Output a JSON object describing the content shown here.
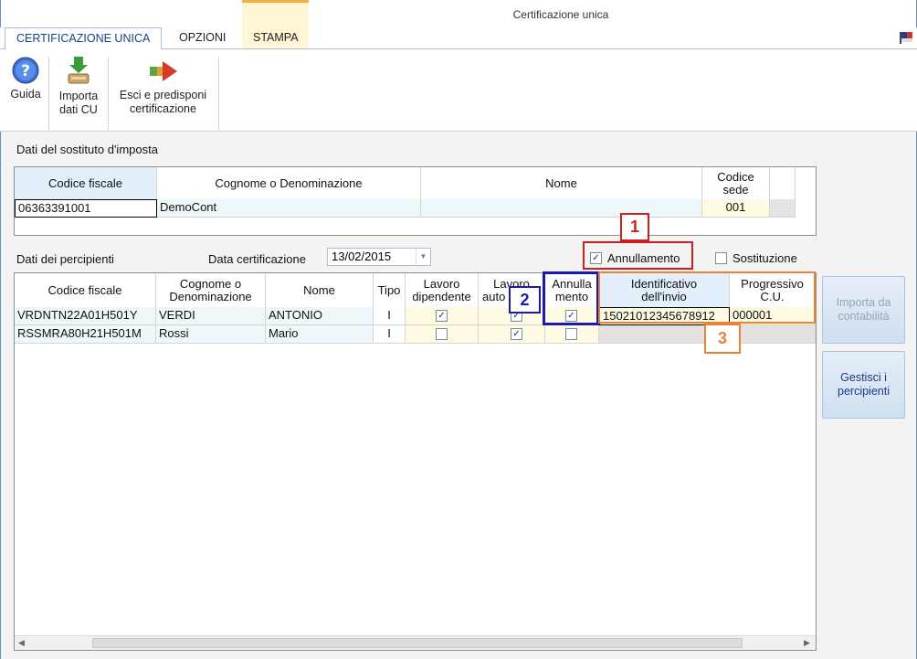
{
  "window": {
    "title": "Certificazione unica"
  },
  "tabs": [
    {
      "label": "CERTIFICAZIONE UNICA"
    },
    {
      "label": "OPZIONI"
    },
    {
      "label": "STAMPA"
    }
  ],
  "ribbon": {
    "help": "Guida",
    "import_l1": "Importa",
    "import_l2": "dati CU",
    "exit_l1": "Esci e predisponi",
    "exit_l2": "certificazione"
  },
  "sostituto": {
    "section_label": "Dati del sostituto d'imposta",
    "headers": {
      "cf": "Codice fiscale",
      "cognome": "Cognome o Denominazione",
      "nome": "Nome",
      "sede_l1": "Codice",
      "sede_l2": "sede"
    },
    "row": {
      "cf": "06363391001",
      "cognome": "DemoCont",
      "nome": "",
      "sede": "001"
    }
  },
  "percipienti": {
    "section_label": "Dati dei percipienti",
    "date_label": "Data certificazione",
    "date_value": "13/02/2015",
    "annullamento_label": "Annullamento",
    "annullamento_checked": true,
    "sostituzione_label": "Sostituzione",
    "sostituzione_checked": false,
    "headers": {
      "cf": "Codice fiscale",
      "cognome_l1": "Cognome o",
      "cognome_l2": "Denominazione",
      "nome": "Nome",
      "tipo": "Tipo",
      "ld_l1": "Lavoro",
      "ld_l2": "dipendente",
      "la_l1": "Lavoro",
      "la_l2": "auto",
      "ann_l1": "Annulla",
      "ann_l2": "mento",
      "id_l1": "Identificativo",
      "id_l2": "dell'invio",
      "prog_l1": "Progressivo",
      "prog_l2": "C.U."
    },
    "rows": [
      {
        "cf": "VRDNTN22A01H501Y",
        "cognome": "VERDI",
        "nome": "ANTONIO",
        "tipo": "I",
        "lav_dip": true,
        "lav_auto": true,
        "annullamento": true,
        "identificativo": "15021012345678912",
        "progressivo": "000001"
      },
      {
        "cf": "RSSMRA80H21H501M",
        "cognome": "Rossi",
        "nome": "Mario",
        "tipo": "I",
        "lav_dip": false,
        "lav_auto": true,
        "annullamento": false,
        "identificativo": "",
        "progressivo": ""
      }
    ]
  },
  "side_buttons": {
    "importa_l1": "Importa da",
    "importa_l2": "contabilità",
    "gestisci_l1": "Gestisci i",
    "gestisci_l2": "percipienti"
  },
  "callouts": {
    "one": "1",
    "two": "2",
    "three": "3"
  },
  "colors": {
    "badge1": "#cc1f1f",
    "badge2": "#1a1ab0",
    "badge3": "#e8813a",
    "tab_active": "#15428b",
    "grid_header": "#e3effb",
    "yellow_cell": "#fffbe3"
  }
}
